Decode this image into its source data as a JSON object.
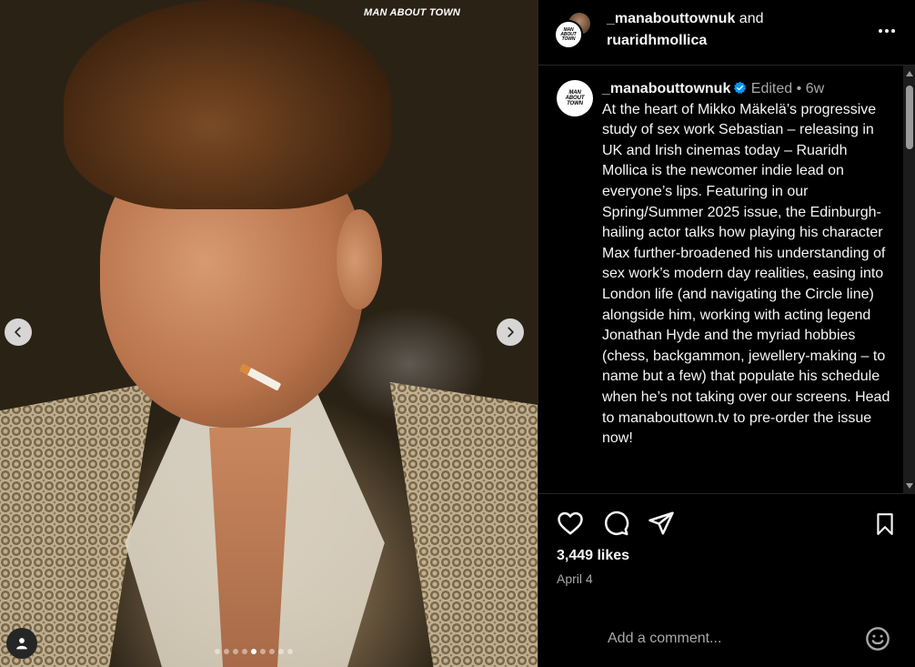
{
  "media": {
    "brand_mark": "MAN ABOUT TOWN",
    "carousel_count": 9,
    "carousel_active_index": 5,
    "icons": {
      "prev": "chevron-left-icon",
      "next": "chevron-right-icon",
      "tag": "user-tag-icon"
    }
  },
  "header": {
    "user_primary": "_manabouttownuk",
    "joiner": "and",
    "user_secondary": "ruaridhmollica",
    "avatar_logo": "MAN ABOUT TOWN",
    "more_icon": "more-horizontal-icon"
  },
  "caption": {
    "username": "_manabouttownuk",
    "edited": "Edited",
    "separator": "•",
    "time_ago": "6w",
    "text": "At the heart of Mikko Mäkelä’s progressive study of sex work Sebastian – releasing in UK and Irish cinemas today – Ruaridh Mollica is the newcomer indie lead on everyone’s lips. Featuring in our Spring/Summer 2025 issue, the Edinburgh-hailing actor talks how playing his character Max further-broadened his understanding of sex work’s modern day realities, easing into London life (and navigating the Circle line) alongside him, working with acting legend Jonathan Hyde and the myriad hobbies (chess, backgammon, jewellery-making – to name but a few) that populate his schedule when he’s not taking over our screens. Head to manabouttown.tv to pre-order the issue now!"
  },
  "actions": {
    "icons": [
      "heart-icon",
      "comment-icon",
      "share-icon",
      "bookmark-icon"
    ],
    "likes": "3,449 likes",
    "date": "April 4"
  },
  "comment": {
    "placeholder": "Add a comment...",
    "emoji_icon": "emoji-icon"
  },
  "colors": {
    "background": "#000000",
    "text": "#f5f5f5",
    "secondary_text": "#a8a8a8",
    "verified": "#0095f6",
    "divider": "#262626"
  }
}
